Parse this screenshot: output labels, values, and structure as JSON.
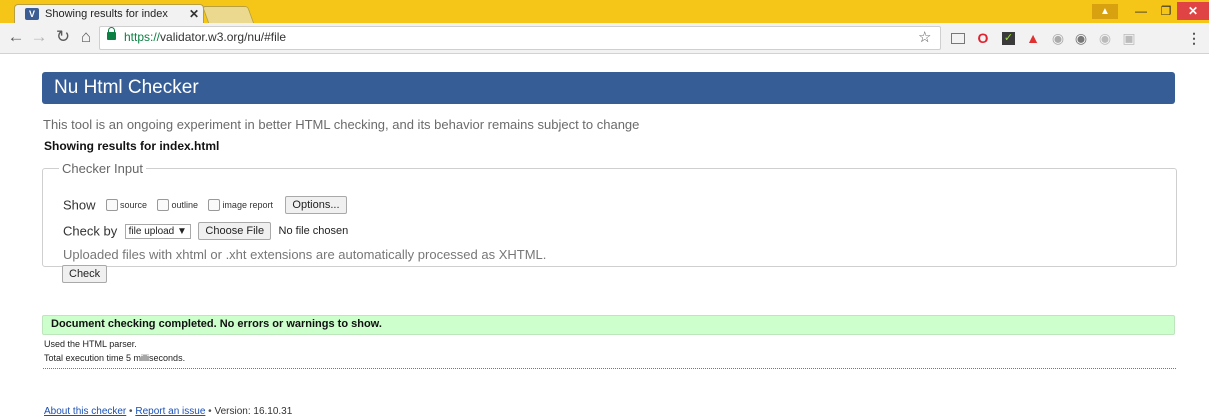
{
  "browser": {
    "tab_title": "Showing results for index",
    "tab_close": "✕",
    "favicon": "V",
    "url_secure_part": "https://",
    "url_host": "validator.w3.org",
    "url_path": "/nu/#file",
    "icons": [
      "back-icon",
      "forward-icon",
      "reload-icon",
      "home-icon",
      "lock-icon",
      "star-icon",
      "cast-icon",
      "opera-icon",
      "check-extension-icon",
      "triangle-extension-icon",
      "menu-icon"
    ]
  },
  "page": {
    "title": "Nu Html Checker",
    "intro": "This tool is an ongoing experiment in better HTML checking, and its behavior remains subject to change",
    "results_heading": "Showing results for index.html",
    "checker_input": {
      "legend": "Checker Input",
      "show_label": "Show",
      "options": [
        {
          "label": "source",
          "checked": false
        },
        {
          "label": "outline",
          "checked": false
        },
        {
          "label": "image report",
          "checked": false
        }
      ],
      "options_button": "Options...",
      "check_by_label": "Check by",
      "check_by_value": "file upload",
      "choose_file_button": "Choose File",
      "file_status": "No file chosen",
      "note": "Uploaded files with xhtml or .xht extensions are automatically processed as XHTML.",
      "check_button": "Check"
    },
    "result_message": "Document checking completed. No errors or warnings to show.",
    "parser_info": "Used the HTML parser.",
    "execution_time": "Total execution time 5 milliseconds.",
    "footer": {
      "about_link": "About this checker",
      "report_link": "Report an issue",
      "separator": "•",
      "version": "Version: 16.10.31"
    }
  },
  "colors": {
    "header_bg": "#365d95",
    "success_bg": "#ccffcc",
    "titlebar": "#f5c518"
  }
}
